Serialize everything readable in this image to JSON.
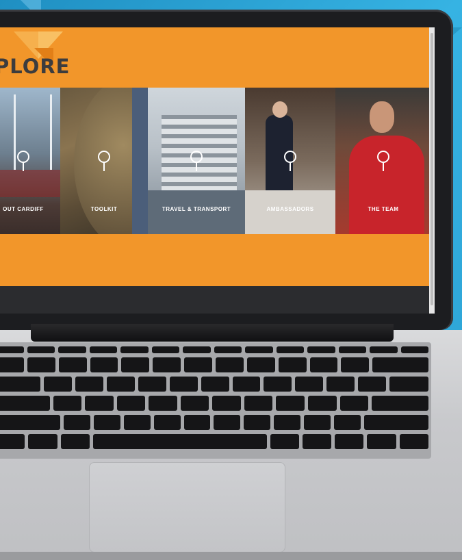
{
  "header": {
    "title": "PLORE"
  },
  "tiles": [
    {
      "label": "OUT CARDIFF",
      "icon": "location-pin-icon"
    },
    {
      "label": "TOOLKIT",
      "icon": "location-pin-icon"
    },
    {
      "label": "TRAVEL & TRANSPORT",
      "icon": "location-pin-icon"
    },
    {
      "label": "AMBASSADORS",
      "icon": "location-pin-icon"
    },
    {
      "label": "THE TEAM",
      "icon": "location-pin-icon"
    }
  ],
  "colors": {
    "accent": "#f2962a",
    "dark": "#2b2c2f",
    "background": "#2fa6d6"
  }
}
